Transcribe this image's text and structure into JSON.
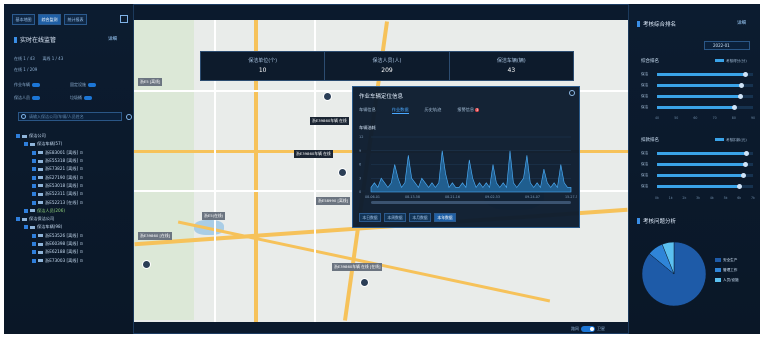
{
  "left": {
    "tabs": [
      "基本地图",
      "综合监测",
      "统计报表"
    ],
    "active_tab": 1,
    "section_title": "实时在线监管",
    "detail_link": "详细",
    "stats": [
      {
        "a": "在线 1 / 43",
        "b": "离线 1 / 43"
      },
      {
        "a": "在线 1 / 209",
        "b": ""
      }
    ],
    "toggles": [
      {
        "label": "作业车辆",
        "label2": "固定设施"
      },
      {
        "label": "保洁人员",
        "label2": "垃圾桶"
      }
    ],
    "search_placeholder": "请输入保洁公司/车辆/人员姓名",
    "tree": [
      {
        "label": "保洁公司",
        "level": 0
      },
      {
        "label": "保洁车辆(57)",
        "level": 1
      },
      {
        "label": "浙E83001 [离线] ⊙",
        "level": 2
      },
      {
        "label": "浙E55318 [离线] ⊙",
        "level": 2
      },
      {
        "label": "浙E73821 [离线] ⊙",
        "level": 2
      },
      {
        "label": "浙E27190 [离线] ⊙",
        "level": 2
      },
      {
        "label": "浙E53018 [离线] ⊙",
        "level": 2
      },
      {
        "label": "浙E52311 [离线] ⊙",
        "level": 2
      },
      {
        "label": "浙E52213 [在线] ⊙",
        "level": 2
      },
      {
        "label": "保洁人员(206)",
        "level": 1,
        "green": true
      },
      {
        "label": "保洁保洁公司",
        "level": 0
      },
      {
        "label": "保洁车辆(98)",
        "level": 1
      },
      {
        "label": "浙E53526 [离线] ⊙",
        "level": 2
      },
      {
        "label": "浙E60398 [离线] ⊙",
        "level": 2
      },
      {
        "label": "浙E62188 [离线] ⊙",
        "level": 2
      },
      {
        "label": "浙E73003 [离线] ⊙",
        "level": 2
      }
    ]
  },
  "stats_bar": [
    {
      "title": "保洁单位(个)",
      "value": "10"
    },
    {
      "title": "保洁人员(人)",
      "value": "209"
    },
    {
      "title": "保洁车辆(辆)",
      "value": "43"
    }
  ],
  "map_labels": [
    "浙E39860车辆 在线",
    "浙E39860车辆 在线",
    "浙E58990 [离线]",
    "浙E39860 [在线]",
    "浙E5 [离线]",
    "浙E5(在线)",
    "浙E39860车辆 在线 [在线]"
  ],
  "popup": {
    "title": "作业车辆定位信息",
    "tabs": [
      "车辆信息",
      "作业数据",
      "历史轨迹",
      "报警信息"
    ],
    "badge": "3",
    "active_tab": 1,
    "subtitle": "车辆油耗",
    "buttons": [
      "本日数据",
      "本周数据",
      "本月数据",
      "本年数据"
    ],
    "active_button": 3
  },
  "right": {
    "title": "考核综合排名",
    "detail_link": "详细",
    "date": "2022-01",
    "rank1": {
      "title": "综合排名",
      "legend": "考核得分(分)",
      "axis": [
        "40",
        "50",
        "60",
        "70",
        "80",
        "90"
      ]
    },
    "rank2": {
      "title": "扣款排名",
      "legend": "考核扣款(元)",
      "axis": [
        "0k",
        "1k",
        "2k",
        "3k",
        "4k",
        "5k",
        "6k",
        "7k"
      ]
    },
    "pie_title": "考核问题分析",
    "pie_legend": [
      "安全生产",
      "管理工作",
      "人员/设施"
    ]
  },
  "bottom_toggle": {
    "left": "路网",
    "right": "卫星"
  },
  "colors": {
    "accent": "#3aa3e8",
    "panel": "#0b1a2d",
    "highlight": "#1f5fa5"
  },
  "chart_data": [
    {
      "type": "bar",
      "title": "综合排名",
      "legend": "考核得分(分)",
      "categories": [
        "保洁",
        "保洁",
        "保洁",
        "保洁"
      ],
      "values": [
        86,
        84,
        83,
        80
      ],
      "xlim": [
        40,
        90
      ]
    },
    {
      "type": "bar",
      "title": "扣款排名",
      "legend": "考核扣款(元)",
      "categories": [
        "保洁",
        "保洁",
        "保洁",
        "保洁"
      ],
      "values": [
        6500,
        6400,
        6300,
        6000
      ],
      "xlim": [
        0,
        7000
      ]
    },
    {
      "type": "area",
      "title": "车辆油耗",
      "x": [
        "08-06-01",
        "08-13-58",
        "08-21-16",
        "09-02-53",
        "09-24-07",
        "15-27-53"
      ],
      "y": [
        1,
        2,
        1,
        3,
        2,
        1,
        2,
        6,
        3,
        1,
        2,
        8,
        3,
        2,
        1,
        3,
        2,
        1,
        2,
        1,
        2,
        9,
        4,
        1,
        2,
        1,
        1,
        2,
        1,
        7,
        3,
        1,
        2,
        1,
        2,
        1,
        6,
        2,
        1,
        2,
        1,
        9,
        2,
        1,
        2,
        3,
        8,
        2,
        1,
        2,
        1,
        5,
        2,
        1,
        2,
        1,
        6,
        2,
        1,
        1
      ],
      "ylim": [
        0,
        12
      ]
    },
    {
      "type": "pie",
      "title": "考核问题分析",
      "labels": [
        "安全生产",
        "管理工作",
        "人员/设施"
      ],
      "values": [
        86,
        8,
        6
      ]
    }
  ]
}
